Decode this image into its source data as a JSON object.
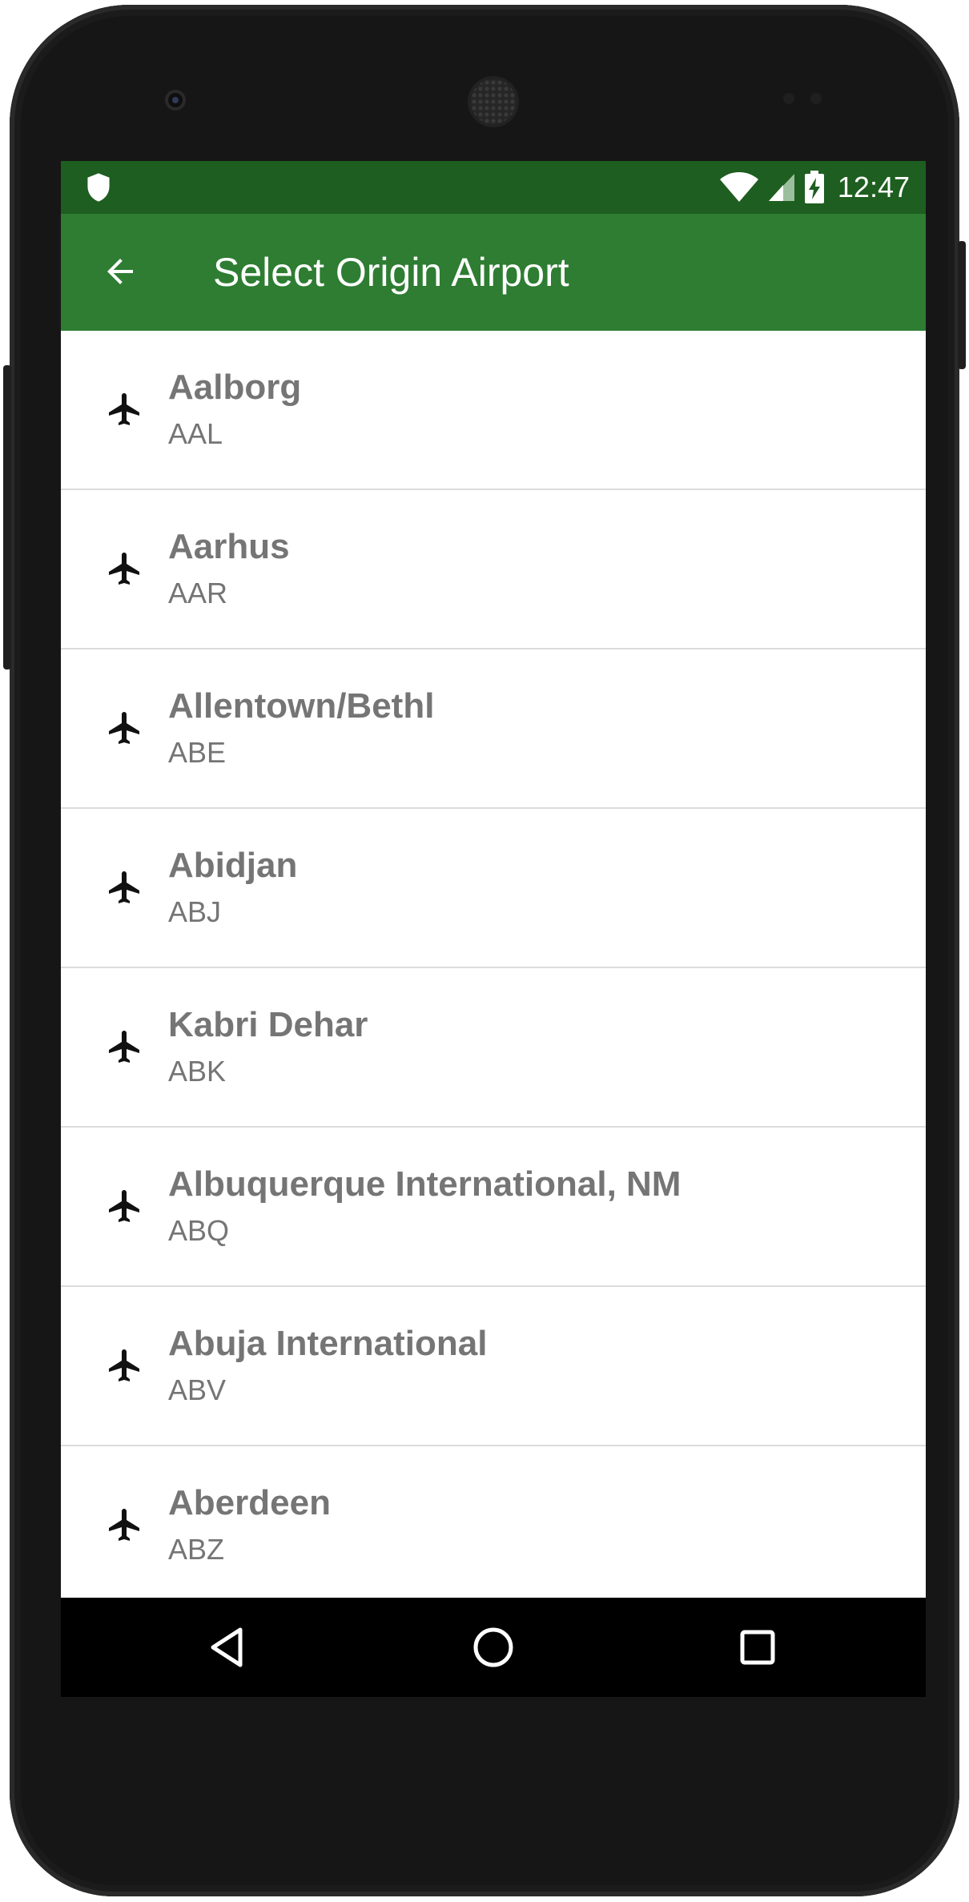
{
  "status_bar": {
    "time": "12:47",
    "icons": [
      "shield-icon",
      "wifi-icon",
      "cell-signal-icon",
      "battery-charging-icon"
    ]
  },
  "app_bar": {
    "title": "Select Origin Airport",
    "back_icon": "arrow-back-icon",
    "color": "#2e7d32",
    "status_color": "#1e5e20"
  },
  "airports": [
    {
      "name": "Aalborg",
      "code": "AAL"
    },
    {
      "name": "Aarhus",
      "code": "AAR"
    },
    {
      "name": "Allentown/Bethl",
      "code": "ABE"
    },
    {
      "name": "Abidjan",
      "code": "ABJ"
    },
    {
      "name": "Kabri Dehar",
      "code": "ABK"
    },
    {
      "name": "Albuquerque International, NM",
      "code": "ABQ"
    },
    {
      "name": "Abuja International",
      "code": "ABV"
    },
    {
      "name": "Aberdeen",
      "code": "ABZ"
    }
  ],
  "list_icon": "airplane-icon",
  "nav_bar": {
    "icons": [
      "back-triangle-icon",
      "home-circle-icon",
      "recents-square-icon"
    ]
  }
}
